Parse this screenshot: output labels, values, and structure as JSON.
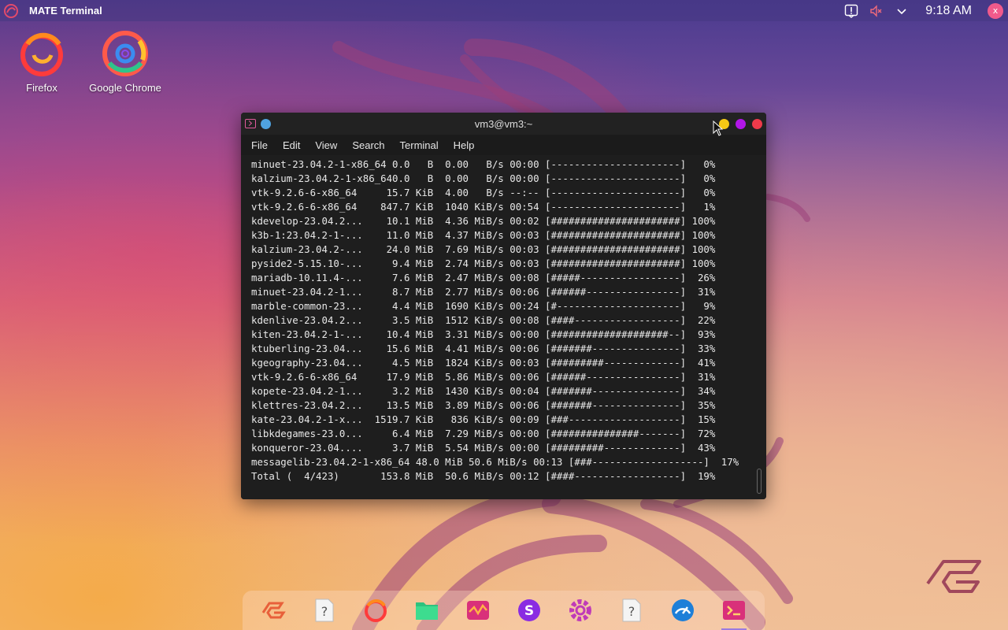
{
  "panel": {
    "title": "MATE Terminal",
    "clock": "9:18 AM",
    "user_initial": "x"
  },
  "desktop": {
    "icons": [
      {
        "label": "Firefox"
      },
      {
        "label": "Google Chrome"
      }
    ]
  },
  "terminal": {
    "title": "vm3@vm3:~",
    "menu": [
      "File",
      "Edit",
      "View",
      "Search",
      "Terminal",
      "Help"
    ],
    "lines": [
      "minuet-23.04.2-1-x86_64 0.0   B  0.00   B/s 00:00 [----------------------]   0%",
      "kalzium-23.04.2-1-x86_640.0   B  0.00   B/s 00:00 [----------------------]   0%",
      "vtk-9.2.6-6-x86_64     15.7 KiB  4.00   B/s --:-- [----------------------]   0%",
      "vtk-9.2.6-6-x86_64    847.7 KiB  1040 KiB/s 00:54 [----------------------]   1%",
      "kdevelop-23.04.2...    10.1 MiB  4.36 MiB/s 00:02 [######################] 100%",
      "k3b-1:23.04.2-1-...    11.0 MiB  4.37 MiB/s 00:03 [######################] 100%",
      "kalzium-23.04.2-...    24.0 MiB  7.69 MiB/s 00:03 [######################] 100%",
      "pyside2-5.15.10-...     9.4 MiB  2.74 MiB/s 00:03 [######################] 100%",
      "mariadb-10.11.4-...     7.6 MiB  2.47 MiB/s 00:08 [#####-----------------]  26%",
      "minuet-23.04.2-1...     8.7 MiB  2.77 MiB/s 00:06 [######----------------]  31%",
      "marble-common-23...     4.4 MiB  1690 KiB/s 00:24 [#---------------------]   9%",
      "kdenlive-23.04.2...     3.5 MiB  1512 KiB/s 00:08 [####------------------]  22%",
      "kiten-23.04.2-1-...    10.4 MiB  3.31 MiB/s 00:00 [####################--]  93%",
      "ktuberling-23.04...    15.6 MiB  4.41 MiB/s 00:06 [#######---------------]  33%",
      "kgeography-23.04...     4.5 MiB  1824 KiB/s 00:03 [#########-------------]  41%",
      "vtk-9.2.6-6-x86_64     17.9 MiB  5.86 MiB/s 00:06 [######----------------]  31%",
      "kopete-23.04.2-1...     3.2 MiB  1430 KiB/s 00:04 [#######---------------]  34%",
      "klettres-23.04.2...    13.5 MiB  3.89 MiB/s 00:06 [#######---------------]  35%",
      "kate-23.04.2-1-x...  1519.7 KiB   836 KiB/s 00:09 [###-------------------]  15%",
      "libkdegames-23.0...     6.4 MiB  7.29 MiB/s 00:00 [###############-------]  72%",
      "konqueror-23.04....     3.7 MiB  5.54 MiB/s 00:00 [#########-------------]  43%",
      "messagelib-23.04.2-1-x86_64 48.0 MiB 50.6 MiB/s 00:13 [###-------------------]  17%",
      "Total (  4/423)       153.8 MiB  50.6 MiB/s 00:12 [####------------------]  19%"
    ]
  },
  "dock": {
    "items": [
      "garuda-logo",
      "unknown-app",
      "firefox",
      "files",
      "system-monitor",
      "app-s",
      "settings-gear",
      "unknown-app-2",
      "gauge",
      "terminal"
    ],
    "active": "terminal"
  },
  "colors": {
    "accent": "#e05a9c",
    "minimize": "#f6c915",
    "maximize": "#b116e8",
    "close": "#ee3a4a"
  }
}
